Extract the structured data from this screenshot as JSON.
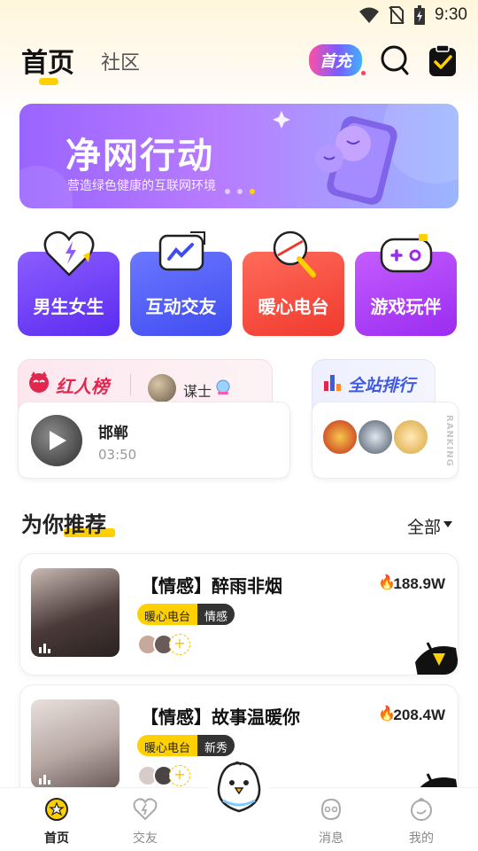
{
  "status_bar": {
    "time": "9:30"
  },
  "header": {
    "tab_home": "首页",
    "tab_community": "社区",
    "recharge_label": "首充"
  },
  "banner": {
    "title": "净网行动",
    "subtitle": "营造绿色健康的互联网环境"
  },
  "categories": [
    {
      "label": "男生女生",
      "color": "#6a3cff"
    },
    {
      "label": "互动交友",
      "color": "#4f5cff"
    },
    {
      "label": "暖心电台",
      "color": "#ff4d40"
    },
    {
      "label": "游戏玩伴",
      "color": "#b63cff"
    }
  ],
  "hot_rank": {
    "title": "红人榜",
    "top_user": "谋士",
    "play_city": "邯郸",
    "play_time": "03:50"
  },
  "site_rank": {
    "title": "全站排行",
    "vertical_label": "RANKING"
  },
  "recommend": {
    "title": "为你推荐",
    "filter_label": "全部"
  },
  "rooms": [
    {
      "title": "【情感】醉雨非烟",
      "heat": "188.9W",
      "tag_primary": "暖心电台",
      "tag_secondary": "情感"
    },
    {
      "title": "【情感】故事温暖你",
      "heat": "208.4W",
      "tag_primary": "暖心电台",
      "tag_secondary": "新秀"
    }
  ],
  "bottom_nav": [
    {
      "label": "首页",
      "active": true
    },
    {
      "label": "交友",
      "active": false
    },
    {
      "label": "消息",
      "active": false
    },
    {
      "label": "我的",
      "active": false
    }
  ],
  "colors": {
    "accent": "#ffd000",
    "brand_purple": "#9a64ff"
  }
}
